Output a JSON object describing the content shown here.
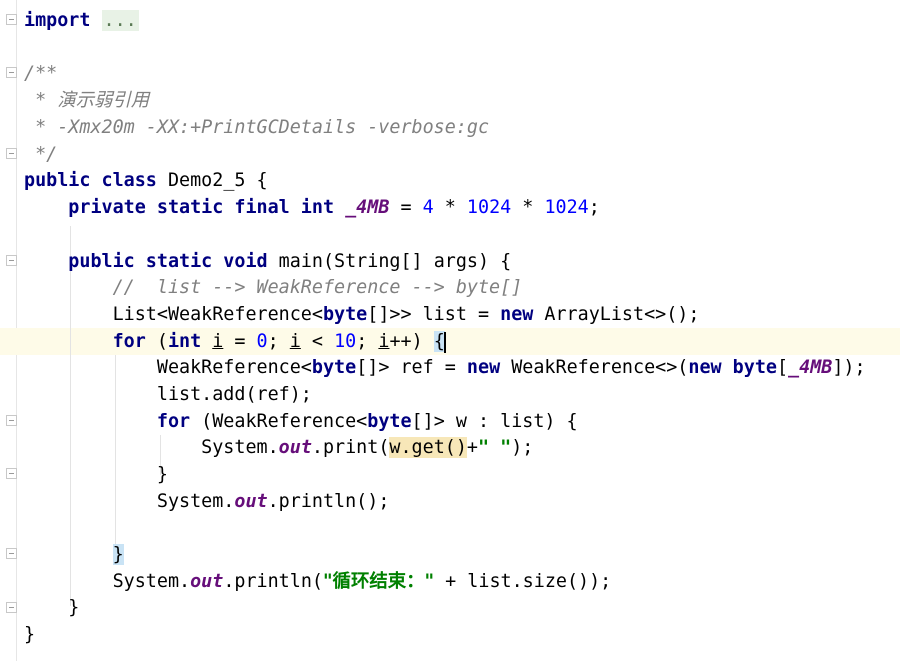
{
  "editor": {
    "class_name": "Demo2_5",
    "lines": {
      "l1": {
        "kw": "import",
        "fold": "..."
      },
      "l2": {
        "c": "/**"
      },
      "l3": {
        "c1": " * ",
        "c2": "演示弱引用"
      },
      "l4": {
        "c": " * -Xmx20m -XX:+PrintGCDetails -verbose:gc"
      },
      "l5": {
        "c": " */"
      },
      "l6": {
        "k1": "public",
        "k2": "class",
        "rest": " Demo2_5 {"
      },
      "l7": {
        "k": "private static final int",
        "const": "_4MB",
        "t1": " = ",
        "n1": "4",
        "t2": " * ",
        "n2": "1024",
        "t3": " * ",
        "n3": "1024",
        "t4": ";"
      },
      "l8": {
        "k": "public static void",
        "rest": " main(String[] args) {"
      },
      "l9": {
        "c": "//  list --> WeakReference --> byte[]"
      },
      "l10": {
        "t1": "List<WeakReference<",
        "k1": "byte",
        "t2": "[]>> list = ",
        "k2": "new",
        "t3": " ArrayList<>();"
      },
      "l11": {
        "k1": "for",
        "t1": " (",
        "k2": "int",
        "t2": " ",
        "i1": "i",
        "t3": " = ",
        "n1": "0",
        "t4": "; ",
        "i2": "i",
        "t5": " < ",
        "n2": "10",
        "t6": "; ",
        "i3": "i",
        "t7": "++) ",
        "b": "{"
      },
      "l12": {
        "t1": "WeakReference<",
        "k1": "byte",
        "t2": "[]> ref = ",
        "k2": "new",
        "t3": " WeakReference<>(",
        "k3": "new",
        "t4": " ",
        "k4": "byte",
        "t5": "[",
        "const": "_4MB",
        "t6": "]);"
      },
      "l13": {
        "t": "list.add(ref);"
      },
      "l14": {
        "k1": "for",
        "t1": " (WeakReference<",
        "k2": "byte",
        "t2": "[]> w : list) {"
      },
      "l15": {
        "t1": "System.",
        "s": "out",
        "t2": ".print(",
        "w": "w.get()",
        "t3": "+",
        "str": "\" \"",
        "t4": ");"
      },
      "l16": {
        "t": "}"
      },
      "l17": {
        "t1": "System.",
        "s": "out",
        "t2": ".println();"
      },
      "l18": {
        "b": "}"
      },
      "l19": {
        "t1": "System.",
        "s": "out",
        "t2": ".println(",
        "str": "\"循环结束：\"",
        "t3": " + list.size());"
      },
      "l20": {
        "t": "}"
      },
      "l21": {
        "t": "}"
      }
    }
  }
}
